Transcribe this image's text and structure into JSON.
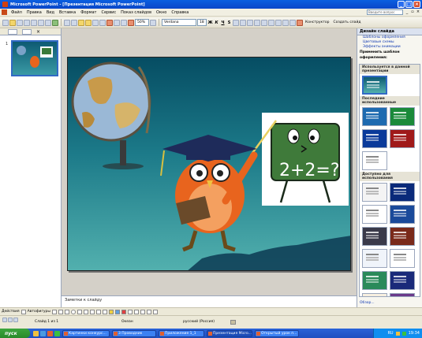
{
  "window": {
    "title": "Microsoft PowerPoint - [Презентация Microsoft PowerPoint]",
    "controls": [
      "_",
      "□",
      "×"
    ]
  },
  "menubar": {
    "items": [
      "Файл",
      "Правка",
      "Вид",
      "Вставка",
      "Формат",
      "Сервис",
      "Показ слайдов",
      "Окно",
      "Справка"
    ],
    "help_placeholder": "Введите вопрос"
  },
  "toolbar": {
    "zoom": "50%",
    "font": "Verdana",
    "size": "18",
    "bold": "Ж",
    "italic": "К",
    "underline": "Ч",
    "strike": "S",
    "designer_label": "Конструктор",
    "new_slide_label": "Создать слайд"
  },
  "left_pane": {
    "slide_number": "1"
  },
  "slide": {
    "board_text": "2+2=?"
  },
  "notes": {
    "placeholder": "Заметки к слайду"
  },
  "task_pane": {
    "title": "Дизайн слайда",
    "links": [
      "Шаблоны оформления",
      "Цветовые схемы",
      "Эффекты анимации"
    ],
    "apply_label": "Применить шаблон оформления:",
    "sections": [
      "Используется в данной презентации",
      "Последние использованные",
      "Доступно для использования"
    ],
    "footer_link": "Обзор..."
  },
  "drawbar": {
    "actions_label": "Действия",
    "autoshapes_label": "Автофигуры"
  },
  "statusbar": {
    "slide_info": "Слайд 1 из 1",
    "design": "Океан",
    "language": "русский (Россия)"
  },
  "taskbar": {
    "start_label": "пуск",
    "tasks": [
      "Картинки конкурс...",
      "3 Проводник",
      "Приложение 1_1",
      "Презентация Micro...",
      "Открытый урок п..."
    ],
    "tray_lang": "RU",
    "clock": "19:34"
  },
  "colors": {
    "titlebar": "#0a5fe0",
    "taskbar": "#2a63d8",
    "start": "#2a8a2a",
    "slide_top": "#064d63",
    "slide_bottom": "#52b0ae",
    "board": "#3f7a3a",
    "owl": "#e8641e"
  }
}
